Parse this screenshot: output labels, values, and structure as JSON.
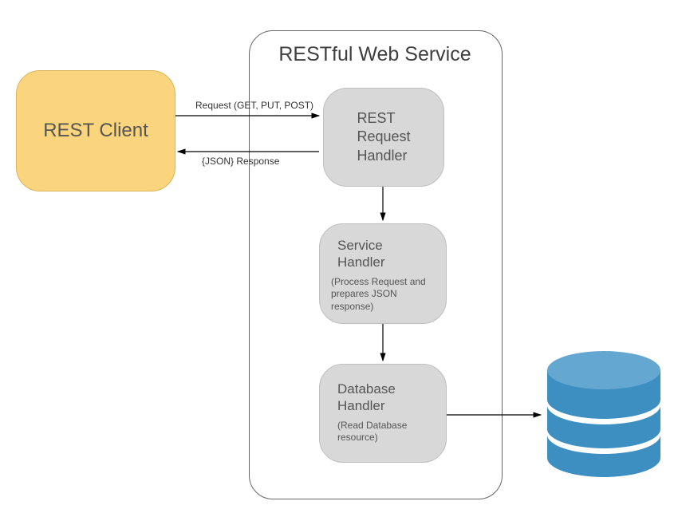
{
  "client": {
    "label": "REST Client"
  },
  "service": {
    "title": "RESTful Web Service",
    "requestHandler": {
      "label": "REST\nRequest\nHandler"
    },
    "serviceHandler": {
      "label": "Service\nHandler",
      "sub": "(Process Request and prepares JSON response)"
    },
    "databaseHandler": {
      "label": "Database\nHandler",
      "sub": "(Read Database resource)"
    }
  },
  "arrows": {
    "request": "Request (GET, PUT, POST)",
    "response": "{JSON} Response"
  },
  "colors": {
    "client_fill": "#fad57e",
    "handler_fill": "#d8d8d8",
    "db_fill": "#3d8fc2",
    "db_gap": "#ffffff"
  }
}
